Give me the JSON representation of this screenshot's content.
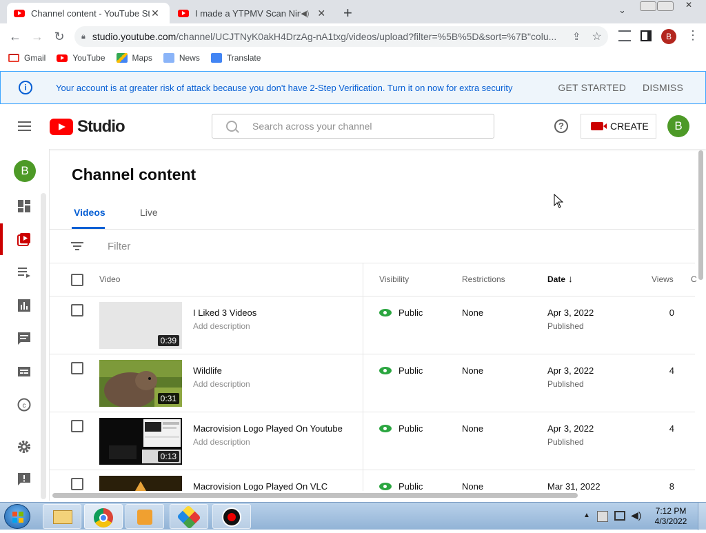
{
  "browser": {
    "tabs": [
      {
        "title": "Channel content - YouTube Studio",
        "active": true
      },
      {
        "title": "I made a YTPMV Scan Ninepence",
        "active": false
      }
    ],
    "url_main": "studio.youtube.com",
    "url_rest": "/channel/UCJTNyK0akH4DrzAg-nA1txg/videos/upload?filter=%5B%5D&sort=%7B\"colu...",
    "profile_initial": "B",
    "bookmarks": [
      "Gmail",
      "YouTube",
      "Maps",
      "News",
      "Translate"
    ]
  },
  "banner": {
    "message": "Your account is at greater risk of attack because you don't have 2-Step Verification. Turn it on now for extra security",
    "get_started": "GET STARTED",
    "dismiss": "DISMISS"
  },
  "header": {
    "logo_text": "Studio",
    "search_placeholder": "Search across your channel",
    "help": "?",
    "create_label": "CREATE",
    "avatar_initial": "B"
  },
  "sidebar": {
    "avatar_initial": "B"
  },
  "page": {
    "title": "Channel content",
    "tabs": [
      "Videos",
      "Live"
    ],
    "filter_label": "Filter",
    "columns": [
      "Video",
      "Visibility",
      "Restrictions",
      "Date",
      "Views",
      "C"
    ]
  },
  "videos": [
    {
      "title": "I Liked 3 Videos",
      "desc": "Add description",
      "duration": "0:39",
      "visibility": "Public",
      "restrictions": "None",
      "date": "Apr 3, 2022",
      "status": "Published",
      "views": "0"
    },
    {
      "title": "Wildlife",
      "desc": "Add description",
      "duration": "0:31",
      "visibility": "Public",
      "restrictions": "None",
      "date": "Apr 3, 2022",
      "status": "Published",
      "views": "4"
    },
    {
      "title": "Macrovision Logo Played On Youtube",
      "desc": "Add description",
      "duration": "0:13",
      "visibility": "Public",
      "restrictions": "None",
      "date": "Apr 3, 2022",
      "status": "Published",
      "views": "4"
    },
    {
      "title": "Macrovision Logo Played On VLC",
      "desc": "",
      "duration": "",
      "visibility": "Public",
      "restrictions": "None",
      "date": "Mar 31, 2022",
      "status": "",
      "views": "8"
    }
  ],
  "taskbar": {
    "time": "7:12 PM",
    "date": "4/3/2022"
  },
  "colors": {
    "accent": "#065fd4",
    "brand": "#ff0000",
    "public": "#2ba640",
    "avatar": "#4d9a27"
  }
}
